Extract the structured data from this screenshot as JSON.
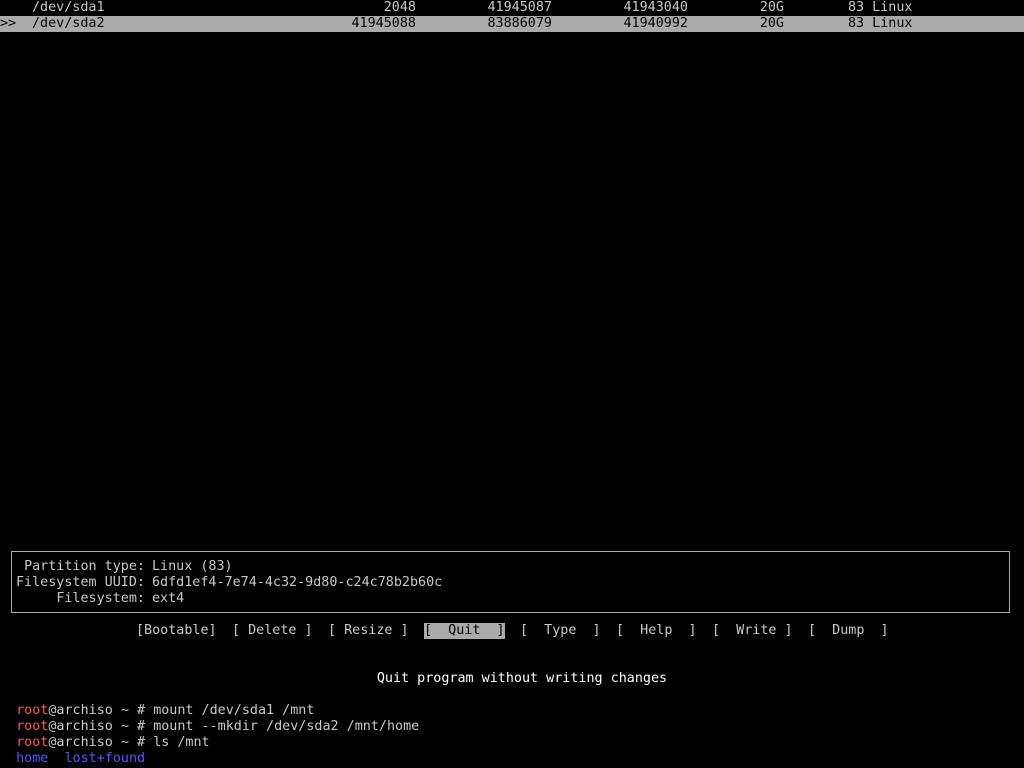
{
  "partitions": [
    {
      "marker": "",
      "device": "/dev/sda1",
      "start": "2048",
      "end": "41945087",
      "sectors": "41943040",
      "size": "20G",
      "type": "83 Linux",
      "selected": false
    },
    {
      "marker": ">>",
      "device": "/dev/sda2",
      "start": "41945088",
      "end": "83886079",
      "sectors": "41940992",
      "size": "20G",
      "type": "83 Linux",
      "selected": true
    }
  ],
  "info": {
    "partition_type_label": "Partition type:",
    "partition_type_value": "Linux (83)",
    "uuid_label": "Filesystem UUID:",
    "uuid_value": "6dfd1ef4-7e74-4c32-9d80-c24c78b2b60c",
    "filesystem_label": "Filesystem:",
    "filesystem_value": "ext4"
  },
  "menu": {
    "bootable": "[Bootable]",
    "delete": "[ Delete ]",
    "resize": "[ Resize ]",
    "quit": "[  Quit  ]",
    "type": "[  Type  ]",
    "help": "[  Help  ]",
    "write": "[  Write ]",
    "dump": "[  Dump  ]",
    "active": "quit"
  },
  "hint": "Quit program without writing changes",
  "terminal": {
    "user": "root",
    "host_prompt": "@archiso ~ # ",
    "lines": [
      "mount /dev/sda1 /mnt",
      "mount --mkdir /dev/sda2 /mnt/home",
      "ls /mnt"
    ],
    "ls_output": [
      "home",
      "lost+found"
    ],
    "current_input": ""
  },
  "colors": {
    "background": "#000000",
    "text": "#c8c8c8",
    "highlight": "#aaaaaa",
    "prompt_user": "#ff5555",
    "directory": "#5555ff"
  }
}
